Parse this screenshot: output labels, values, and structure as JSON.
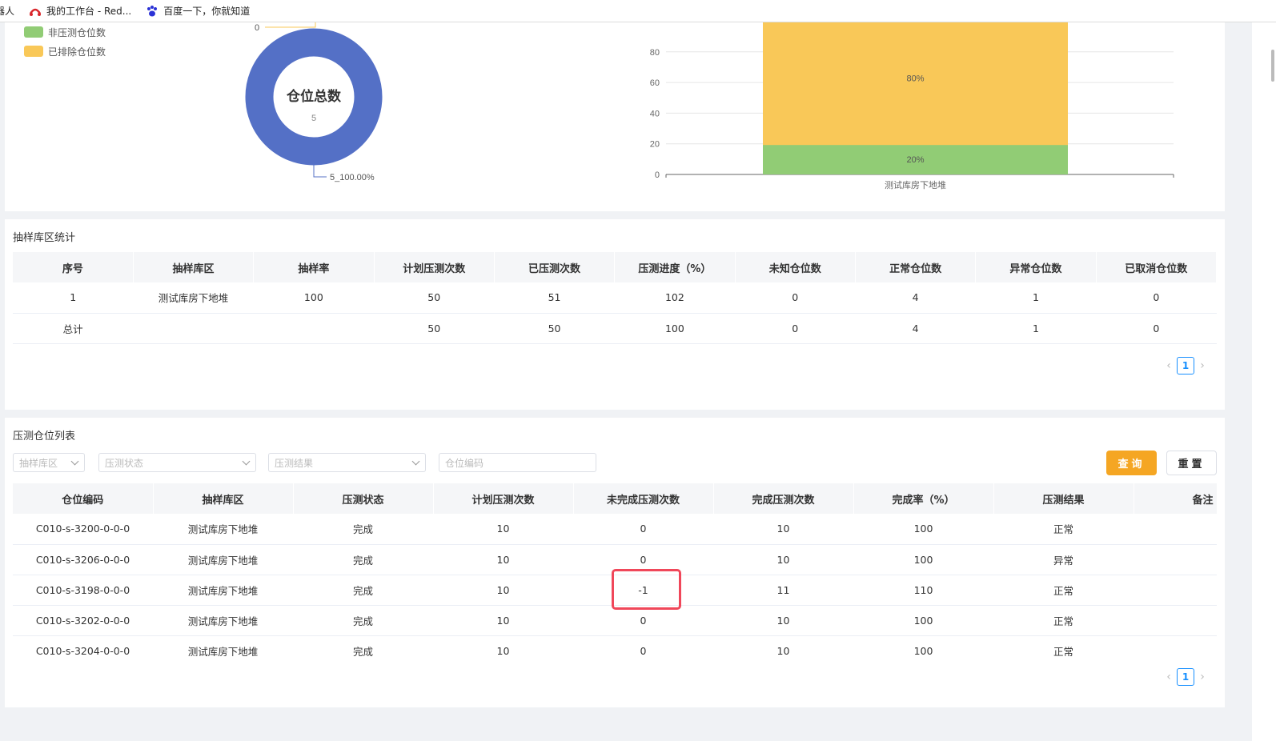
{
  "bookmarks": [
    {
      "label": "器人",
      "icon": "robot-icon"
    },
    {
      "label": "我的工作台 - Red...",
      "icon": "redhat-icon"
    },
    {
      "label": "百度一下，你就知道",
      "icon": "baidu-paw-icon"
    }
  ],
  "colors": {
    "blue": "#5470c6",
    "green": "#91cc75",
    "yellow": "#f9c858",
    "accent": "#f5a623",
    "link": "#1890ff",
    "highlight": "#f0475a"
  },
  "legend": [
    {
      "label": "非压测仓位数",
      "color": "#91cc75"
    },
    {
      "label": "已排除仓位数",
      "color": "#f9c858"
    }
  ],
  "chart_data": [
    {
      "type": "pie",
      "center_title": "仓位总数",
      "center_value": "5",
      "slices": [
        {
          "label": "5_100.00%",
          "value": 5,
          "color": "#5470c6"
        },
        {
          "label": "0",
          "value": 0,
          "color": "#f9c858"
        }
      ]
    },
    {
      "type": "bar",
      "stacked": true,
      "categories": [
        "测试库房下地堆"
      ],
      "ylim": [
        0,
        100
      ],
      "yticks": [
        0,
        20,
        40,
        60,
        80
      ],
      "series": [
        {
          "values": [
            20
          ],
          "label": "20%",
          "color": "#91cc75"
        },
        {
          "values": [
            80
          ],
          "label": "80%",
          "color": "#f9c858"
        }
      ],
      "grid": true
    }
  ],
  "sample_stats": {
    "title": "抽样库区统计",
    "columns": [
      "序号",
      "抽样库区",
      "抽样率",
      "计划压测次数",
      "已压测次数",
      "压测进度（%）",
      "未知仓位数",
      "正常仓位数",
      "异常仓位数",
      "已取消仓位数"
    ],
    "rows": [
      [
        "1",
        "测试库房下地堆",
        "100",
        "50",
        "51",
        "102",
        "0",
        "4",
        "1",
        "0"
      ],
      [
        "总计",
        "",
        "",
        "50",
        "50",
        "100",
        "0",
        "4",
        "1",
        "0"
      ]
    ],
    "page": "1"
  },
  "slot_list": {
    "title": "压测仓位列表",
    "filters": {
      "area_placeholder": "抽样库区",
      "status_placeholder": "压测状态",
      "result_placeholder": "压测结果",
      "code_placeholder": "仓位编码"
    },
    "query_label": "查询",
    "reset_label": "重置",
    "columns": [
      "仓位编码",
      "抽样库区",
      "压测状态",
      "计划压测次数",
      "未完成压测次数",
      "完成压测次数",
      "完成率（%）",
      "压测结果",
      "备注"
    ],
    "rows": [
      [
        "C010-s-3200-0-0-0",
        "测试库房下地堆",
        "完成",
        "10",
        "0",
        "10",
        "100",
        "正常",
        ""
      ],
      [
        "C010-s-3206-0-0-0",
        "测试库房下地堆",
        "完成",
        "10",
        "0",
        "10",
        "100",
        "异常",
        ""
      ],
      [
        "C010-s-3198-0-0-0",
        "测试库房下地堆",
        "完成",
        "10",
        "-1",
        "11",
        "110",
        "正常",
        ""
      ],
      [
        "C010-s-3202-0-0-0",
        "测试库房下地堆",
        "完成",
        "10",
        "0",
        "10",
        "100",
        "正常",
        ""
      ],
      [
        "C010-s-3204-0-0-0",
        "测试库房下地堆",
        "完成",
        "10",
        "0",
        "10",
        "100",
        "正常",
        ""
      ]
    ],
    "page": "1"
  }
}
